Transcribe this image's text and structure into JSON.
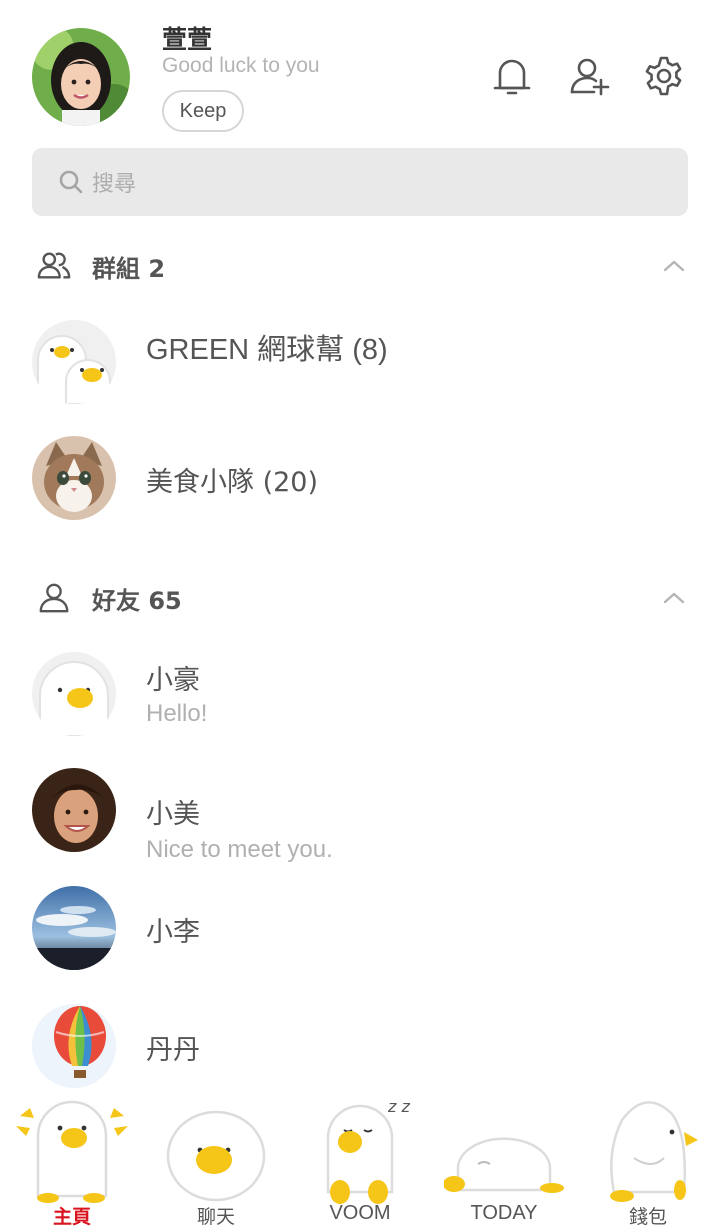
{
  "profile": {
    "name": "萱萱",
    "status": "Good luck to you",
    "keep_label": "Keep"
  },
  "header_icons": [
    "bell-icon",
    "add-friend-icon",
    "gear-icon"
  ],
  "search": {
    "placeholder": "搜尋"
  },
  "groups": {
    "title": "群組 2",
    "items": [
      {
        "name": "GREEN 網球幫 (8)"
      },
      {
        "name": "美食小隊 (20)"
      }
    ]
  },
  "friends": {
    "title": "好友 65",
    "items": [
      {
        "name": "小豪",
        "status": "Hello!"
      },
      {
        "name": "小美",
        "status": "Nice to meet you."
      },
      {
        "name": "小李"
      },
      {
        "name": "丹丹"
      }
    ]
  },
  "tabs": [
    {
      "label": "主頁",
      "active": true
    },
    {
      "label": "聊天"
    },
    {
      "label": "VOOM"
    },
    {
      "label": "TODAY"
    },
    {
      "label": "錢包"
    }
  ],
  "colors": {
    "active_tab": "#d9141e",
    "mascot_beak": "#f5c518",
    "search_bg": "#e9e9e9"
  }
}
